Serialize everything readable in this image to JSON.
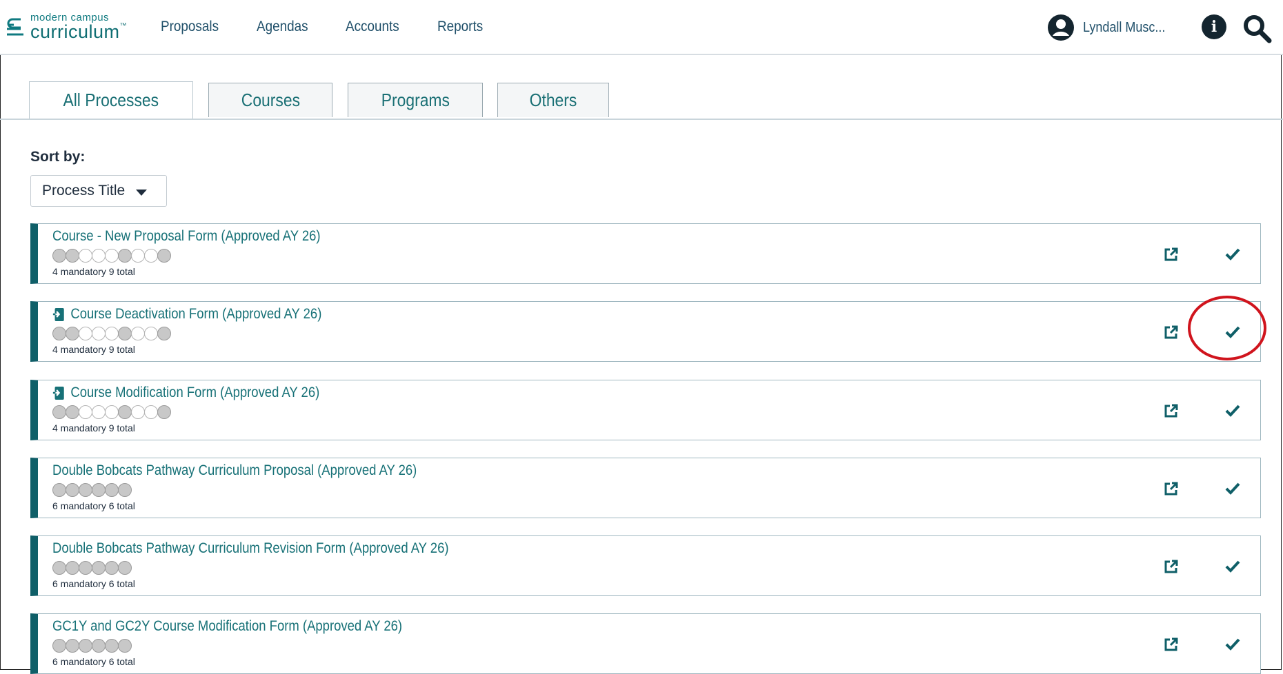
{
  "app": {
    "logo_small": "modern campus",
    "logo_big": "curriculum",
    "logo_tm": "™"
  },
  "nav": {
    "links": [
      "Proposals",
      "Agendas",
      "Accounts",
      "Reports"
    ],
    "user_name": "Lyndall Musc...",
    "icons": [
      "user-avatar-icon",
      "info-icon",
      "search-icon"
    ]
  },
  "tabs": [
    {
      "label": "All Processes",
      "active": true
    },
    {
      "label": "Courses",
      "active": false
    },
    {
      "label": "Programs",
      "active": false
    },
    {
      "label": "Others",
      "active": false
    }
  ],
  "sort": {
    "label": "Sort by:",
    "selected": "Process Title"
  },
  "processes": [
    {
      "title": "Course - New Proposal Form (Approved AY 26)",
      "has_icon": false,
      "summary": "4 mandatory 9 total",
      "steps": [
        1,
        1,
        0,
        0,
        0,
        1,
        0,
        0,
        1
      ]
    },
    {
      "title": "Course Deactivation Form (Approved AY 26)",
      "has_icon": true,
      "summary": "4 mandatory 9 total",
      "steps": [
        1,
        1,
        0,
        0,
        0,
        1,
        0,
        0,
        1
      ]
    },
    {
      "title": "Course Modification Form (Approved AY 26)",
      "has_icon": true,
      "summary": "4 mandatory 9 total",
      "steps": [
        1,
        1,
        0,
        0,
        0,
        1,
        0,
        0,
        1
      ]
    },
    {
      "title": "Double Bobcats Pathway Curriculum Proposal (Approved AY 26)",
      "has_icon": false,
      "summary": "6 mandatory 6 total",
      "steps": [
        1,
        1,
        1,
        1,
        1,
        1
      ]
    },
    {
      "title": "Double Bobcats Pathway Curriculum Revision Form (Approved AY 26)",
      "has_icon": false,
      "summary": "6 mandatory 6 total",
      "steps": [
        1,
        1,
        1,
        1,
        1,
        1
      ]
    },
    {
      "title": "GC1Y and GC2Y Course Modification Form (Approved AY 26)",
      "has_icon": false,
      "summary": "6 mandatory 6 total",
      "steps": [
        1,
        1,
        1,
        1,
        1,
        1
      ]
    }
  ],
  "colors": {
    "accent": "#177177",
    "card_bar": "#0f5f68",
    "highlight": "#d0141d"
  }
}
